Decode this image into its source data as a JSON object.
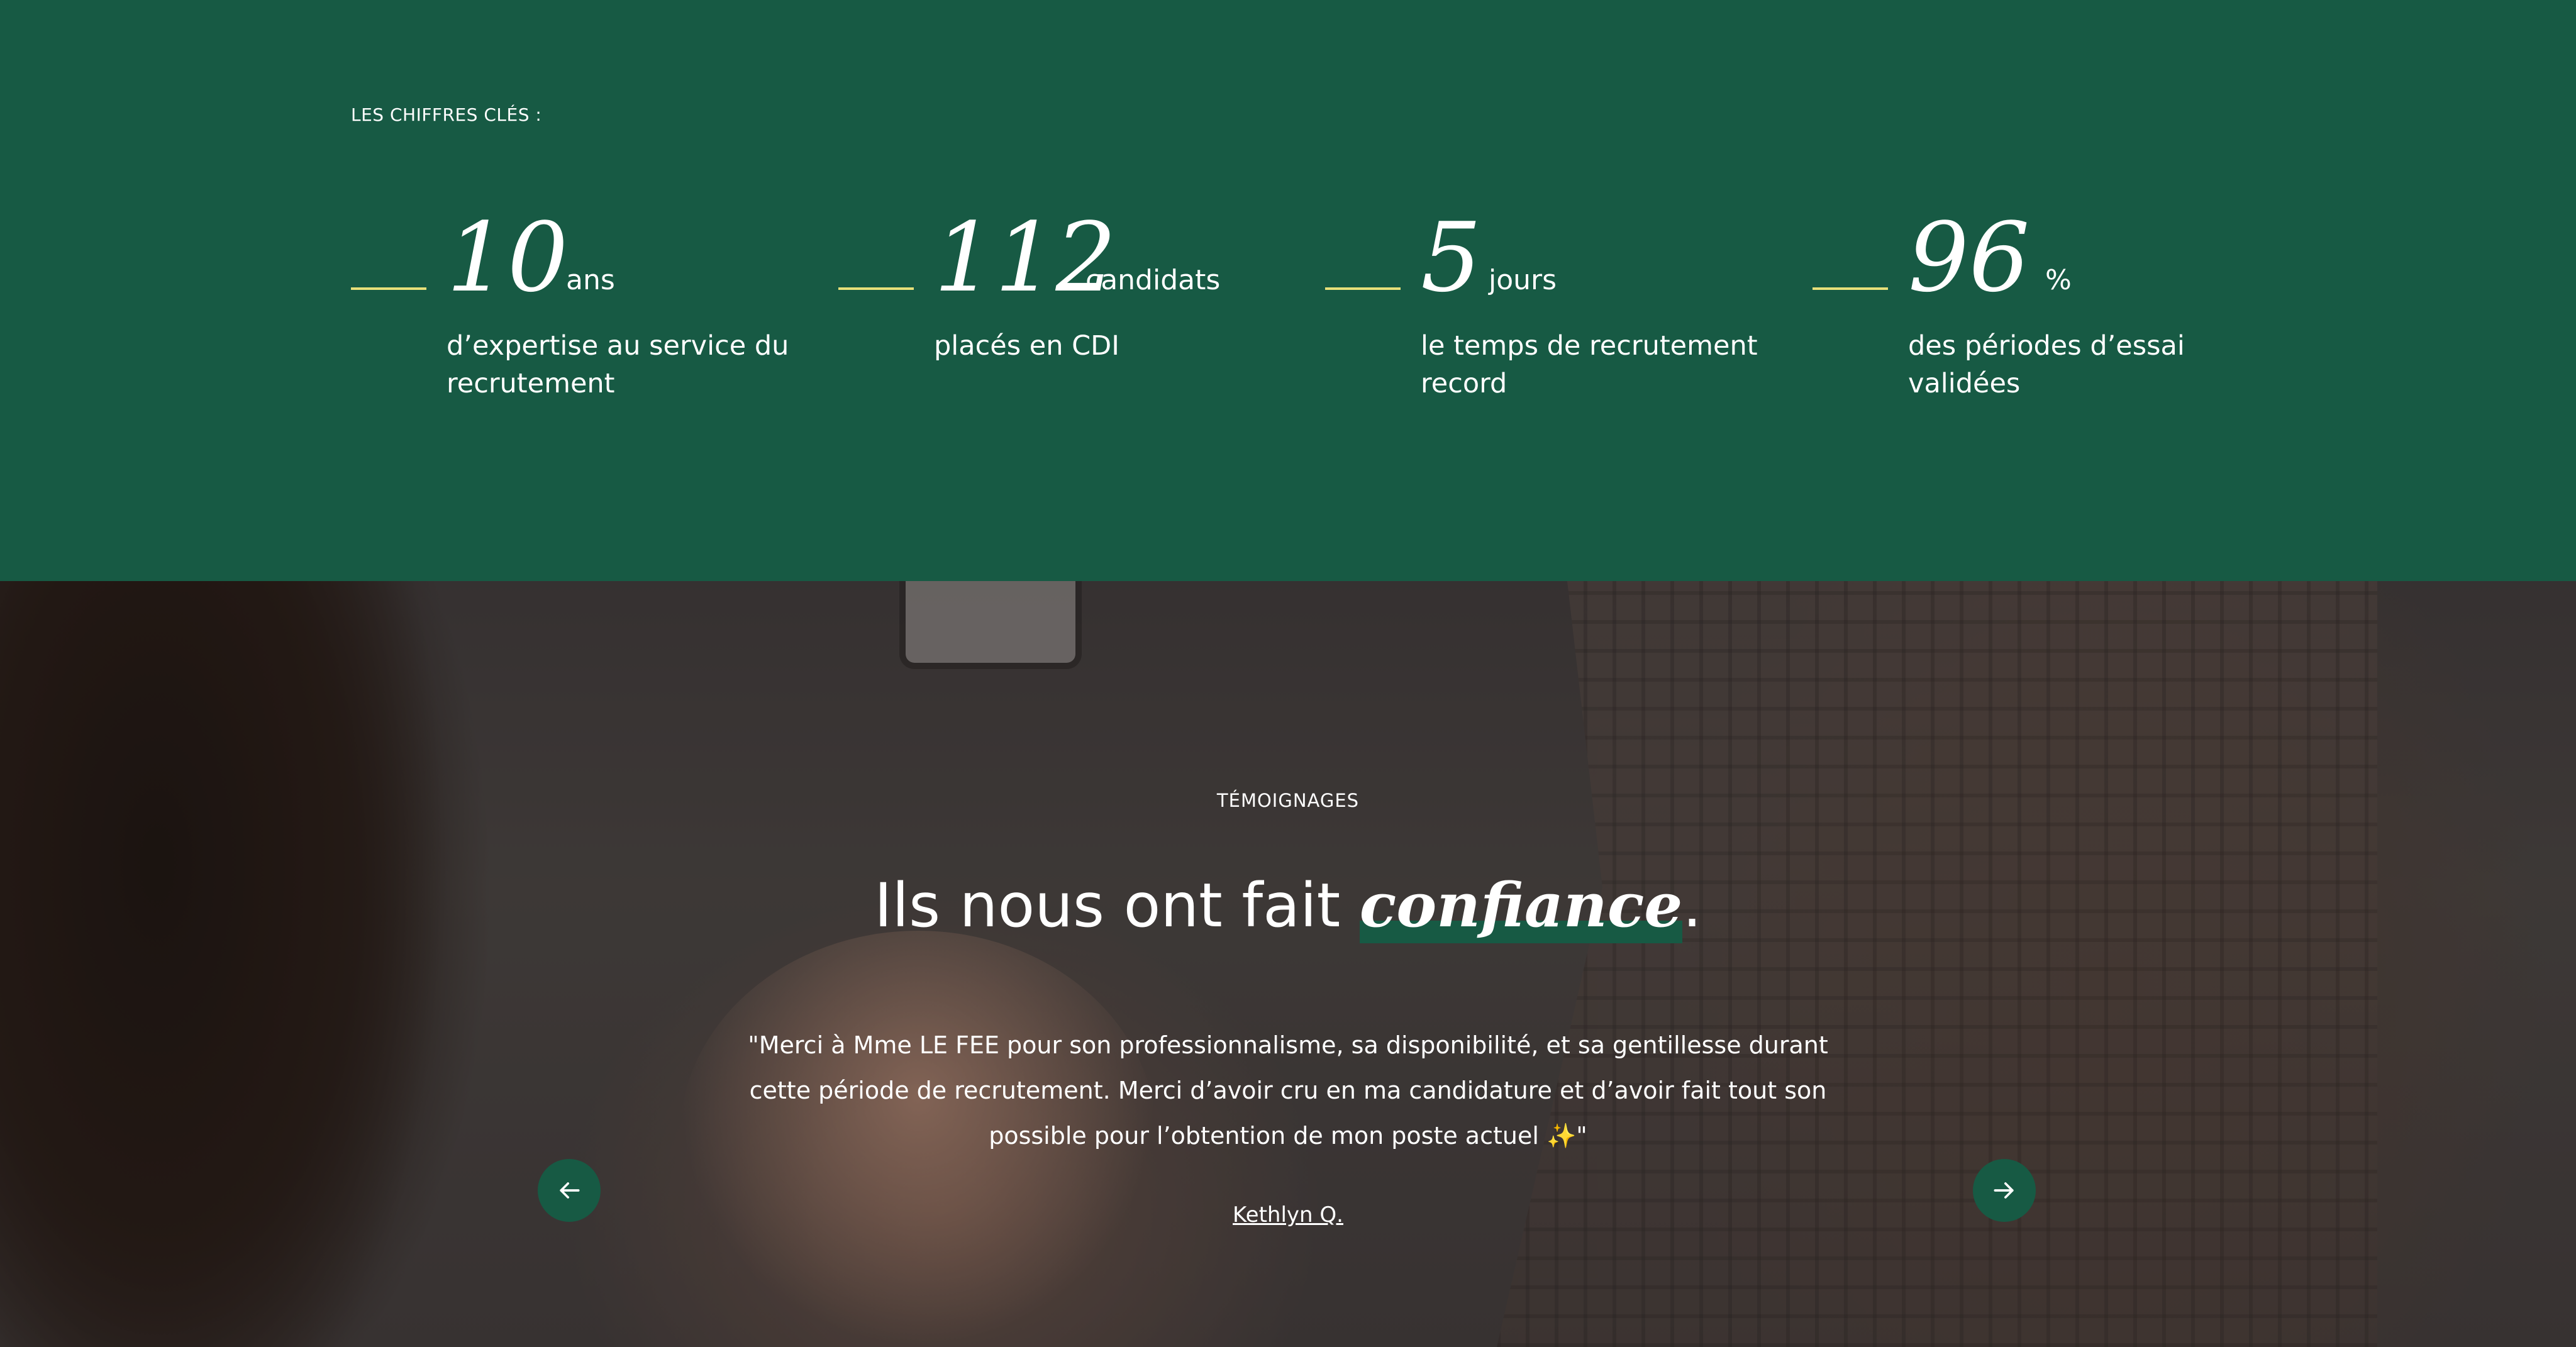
{
  "stats": {
    "label": "LES CHIFFRES CLÉS :",
    "accent_color": "#e8e07a",
    "background_color": "#175a44",
    "items": [
      {
        "number": "10",
        "unit": "ans",
        "description": "d’expertise au service du recrutement"
      },
      {
        "number": "112",
        "unit": "candidats",
        "description": "placés en CDI"
      },
      {
        "number": "5",
        "unit": "jours",
        "description": "le temps de recrutement record"
      },
      {
        "number": "96",
        "unit": "%",
        "description": "des périodes d’essai validées"
      }
    ]
  },
  "testimonials": {
    "eyebrow": "TÉMOIGNAGES",
    "title_prefix": "Ils nous ont fait ",
    "title_accent": "confiance",
    "title_suffix": ".",
    "quote": "\"Merci à Mme LE FEE pour son professionnalisme, sa disponibilité, et sa gentillesse durant cette période de recrutement. Merci d’avoir cru en ma candidature et d’avoir fait tout son possible pour l’obtention de mon poste actuel ✨\"",
    "author": "Kethlyn Q.",
    "prev_icon": "arrow-left-icon",
    "next_icon": "arrow-right-icon"
  }
}
